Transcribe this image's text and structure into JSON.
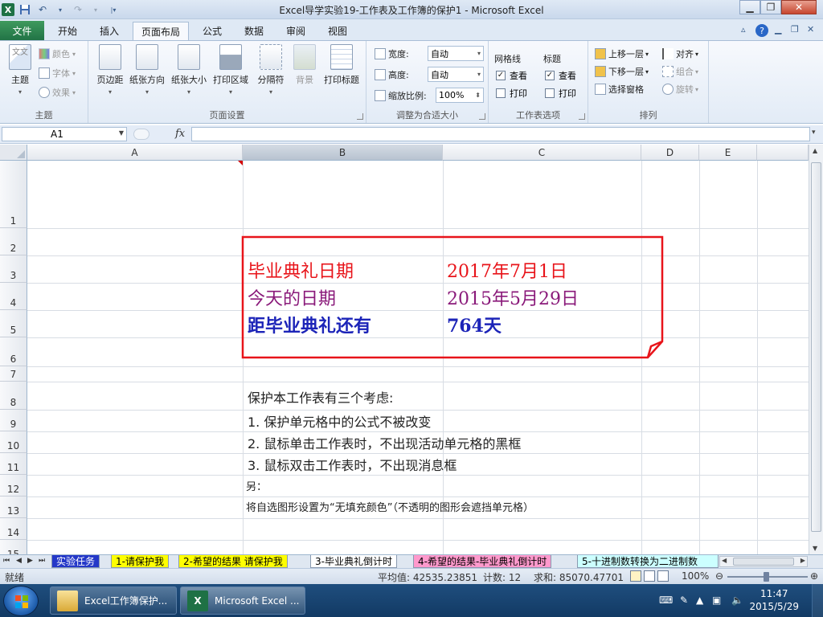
{
  "window": {
    "title": "Excel导学实验19-工作表及工作簿的保护1 - Microsoft Excel"
  },
  "ribbon": {
    "tabs": [
      "文件",
      "开始",
      "插入",
      "页面布局",
      "公式",
      "数据",
      "审阅",
      "视图"
    ],
    "active_tab": "页面布局",
    "groups": {
      "theme": {
        "label": "主题",
        "theme_btn": "主题",
        "colors": "颜色",
        "fonts": "字体",
        "effects": "效果"
      },
      "page_setup": {
        "label": "页面设置",
        "margins": "页边距",
        "orientation": "纸张方向",
        "size": "纸张大小",
        "print_area": "打印区域",
        "breaks": "分隔符",
        "background": "背景",
        "print_titles": "打印标题"
      },
      "scale": {
        "label": "调整为合适大小",
        "width_label": "宽度:",
        "width_value": "自动",
        "height_label": "高度:",
        "height_value": "自动",
        "scale_label": "缩放比例:",
        "scale_value": "100%"
      },
      "sheet_options": {
        "label": "工作表选项",
        "gridlines": "网格线",
        "headings": "标题",
        "view": "查看",
        "print": "打印"
      },
      "arrange": {
        "label": "排列",
        "bring_forward": "上移一层",
        "send_backward": "下移一层",
        "selection_pane": "选择窗格",
        "align": "对齐",
        "group": "组合",
        "rotate": "旋转"
      }
    }
  },
  "formula_bar": {
    "name_box": "A1",
    "fx": "fx",
    "value": ""
  },
  "columns": [
    "A",
    "B",
    "C",
    "D",
    "E"
  ],
  "rows": [
    "1",
    "2",
    "3",
    "4",
    "5",
    "6",
    "7",
    "8",
    "9",
    "10",
    "11",
    "12",
    "13",
    "14",
    "15"
  ],
  "cells": {
    "b3": "毕业典礼日期",
    "c3": "2017年7月1日",
    "b4": "今天的日期",
    "c4": "2015年5月29日",
    "b5": "距毕业典礼还有",
    "c5": "764天",
    "b8": "保护本工作表有三个考虑:",
    "b9": "1.  保护单元格中的公式不被改变",
    "b10": "2.  鼠标单击工作表时，不出现活动单元格的黑框",
    "b11": "3.  鼠标双击工作表时，不出现消息框",
    "b12": "另：",
    "b13": "将自选图形设置为“无填充颜色”（不透明的图形会遮挡单元格）"
  },
  "cell_colors": {
    "row3": "#e8141a",
    "row4": "#8a1a7a",
    "row5": "#1c24b8",
    "shape_border": "#e8141a"
  },
  "sheet_tabs": [
    {
      "label": "实验任务",
      "color": "#2438c8",
      "text_color": "#ffffff"
    },
    {
      "label": "1-请保护我",
      "color": "#ffff00",
      "text_color": "#000000"
    },
    {
      "label": "2-希望的结果 请保护我",
      "color": "#ffff00",
      "text_color": "#000000"
    },
    {
      "label": "3-毕业典礼倒计时",
      "color": "#ffffff",
      "text_color": "#000000"
    },
    {
      "label": "4-希望的结果-毕业典礼倒计时",
      "color": "#ff99cc",
      "text_color": "#000000"
    },
    {
      "label": "5-十进制数转换为二进制数",
      "color": "#ccffff",
      "text_color": "#000000"
    }
  ],
  "status": {
    "mode": "就绪",
    "average": "平均值: 42535.23851",
    "count": "计数: 12",
    "sum": "求和: 85070.47701",
    "zoom": "100%"
  },
  "taskbar": {
    "items": [
      "Excel工作簿保护...",
      "Microsoft Excel ..."
    ],
    "time": "11:47",
    "date": "2015/5/29"
  }
}
